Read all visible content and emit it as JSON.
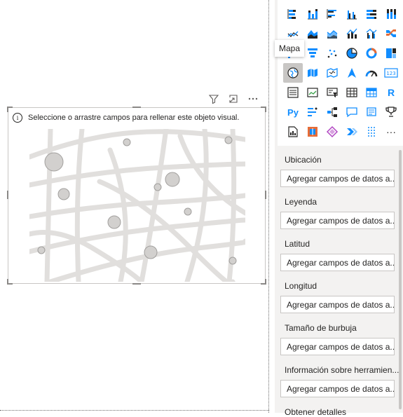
{
  "visual": {
    "info_text": "Seleccione o arrastre campos para rellenar este objeto visual."
  },
  "visual_header": {
    "icons": [
      "filter-icon",
      "focus-mode-icon",
      "more-options-icon"
    ]
  },
  "gallery": {
    "tooltip": "Mapa",
    "more_glyph": "···",
    "r_label": "R",
    "py_label": "Py",
    "num_label": "123"
  },
  "fields": {
    "wells": [
      {
        "label": "Ubicación",
        "placeholder": "Agregar campos de datos a..."
      },
      {
        "label": "Leyenda",
        "placeholder": "Agregar campos de datos a..."
      },
      {
        "label": "Latitud",
        "placeholder": "Agregar campos de datos a..."
      },
      {
        "label": "Longitud",
        "placeholder": "Agregar campos de datos a..."
      },
      {
        "label": "Tamaño de burbuja",
        "placeholder": "Agregar campos de datos a..."
      },
      {
        "label": "Información sobre herramien...",
        "placeholder": "Agregar campos de datos a..."
      }
    ],
    "last_label": "Obtener detalles"
  },
  "colors": {
    "accent_blue": "#118dff",
    "accent_dark": "#252423",
    "accent_orange": "#e66c37"
  }
}
